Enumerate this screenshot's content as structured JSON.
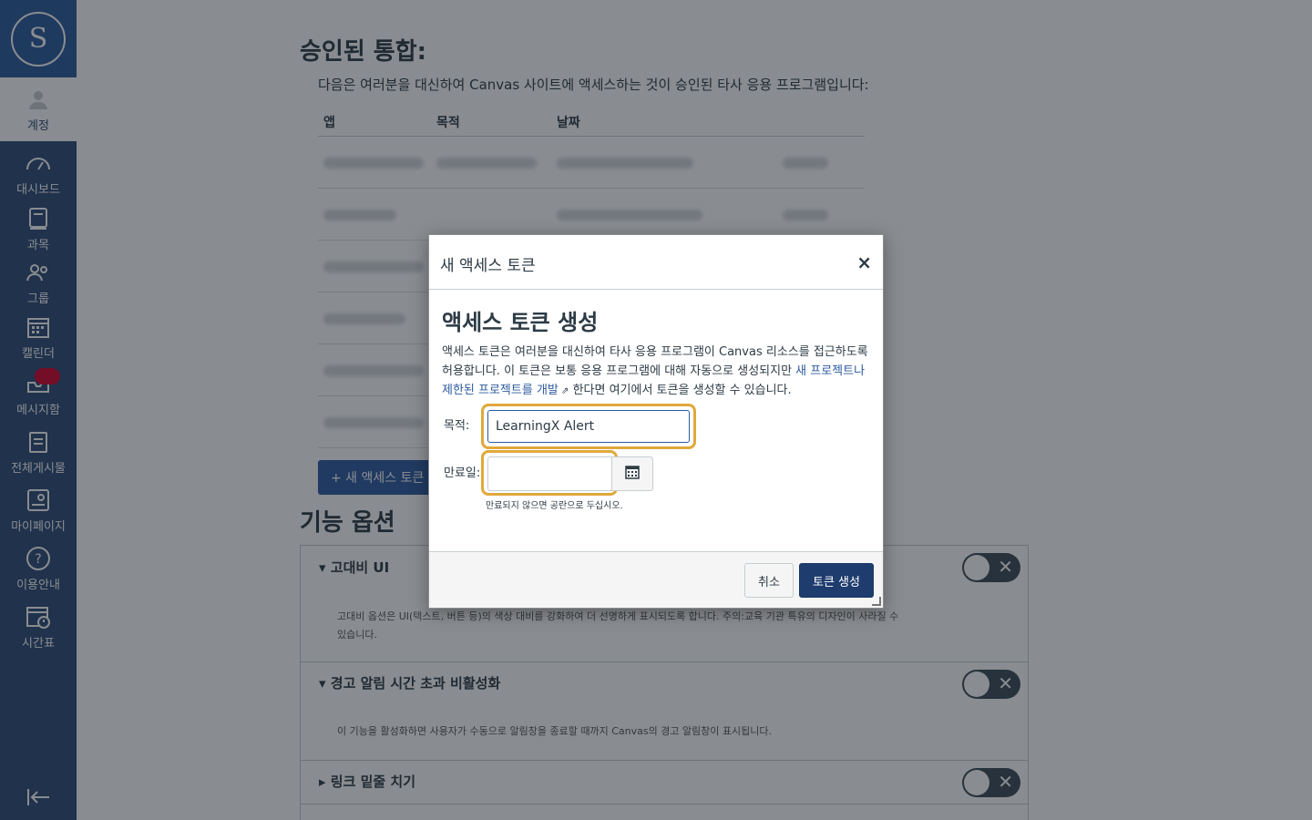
{
  "nav": {
    "items": [
      {
        "label": "계정",
        "icon": "account-icon"
      },
      {
        "label": "대시보드",
        "icon": "dashboard-icon"
      },
      {
        "label": "과목",
        "icon": "courses-icon"
      },
      {
        "label": "그룹",
        "icon": "groups-icon"
      },
      {
        "label": "캘린더",
        "icon": "calendar-icon"
      },
      {
        "label": "메시지함",
        "icon": "inbox-icon"
      },
      {
        "label": "전체게시물",
        "icon": "posts-icon"
      },
      {
        "label": "마이페이지",
        "icon": "mypage-icon"
      },
      {
        "label": "이용안내",
        "icon": "help-icon"
      },
      {
        "label": "시간표",
        "icon": "timetable-icon"
      }
    ]
  },
  "page": {
    "approved_title": "승인된 통합:",
    "approved_desc": "다음은 여러분을 대신하여 Canvas 사이트에 액세스하는 것이 승인된 타사 응용 프로그램입니다:",
    "table_headers": [
      "앱",
      "목적",
      "날짜"
    ],
    "new_token_button": "+ 새 액세스 토큰",
    "features_title": "기능 옵션",
    "features": [
      {
        "title": "고대비 UI",
        "desc": "고대비 옵션은 UI(텍스트, 버튼 등)의 색상 대비를 강화하여 더 선명하게 표시되도록 합니다. 주의:교육 기관 특유의 디자인이 사라질 수 있습니다."
      },
      {
        "title": "경고 알림 시간 초과 비활성화",
        "desc": "이 기능을 활성화하면 사용자가 수동으로 알림창을 종료할 때까지 Canvas의 경고 알림창이 표시됩니다."
      },
      {
        "title": "링크 밑줄 치기",
        "desc": ""
      }
    ]
  },
  "dialog": {
    "title": "새 액세스 토큰",
    "close": "×",
    "heading": "액세스 토큰 생성",
    "para_1": "액세스 토큰은 여러분을 대신하여 타사 응용 프로그램이 Canvas 리소스를 접근하도록 허용합니다. 이 토큰은 보통 응용 프로그램에 대해 자동으로 생성되지만 ",
    "para_link": "새 프로젝트나 제한된 프로젝트를 개발",
    "para_2": " 한다면 여기에서 토큰을 생성할 수 있습니다.",
    "purpose_label": "목적:",
    "purpose_value": "LearningX Alert",
    "expire_label": "만료일:",
    "expire_value": "",
    "expire_hint": "만료되지 않으면 공란으로 두십시오.",
    "cancel_label": "취소",
    "create_label": "토큰 생성"
  },
  "colors": {
    "nav_bg": "#2d4a77",
    "primary": "#1f3c6e",
    "highlight": "#e0a93b"
  }
}
